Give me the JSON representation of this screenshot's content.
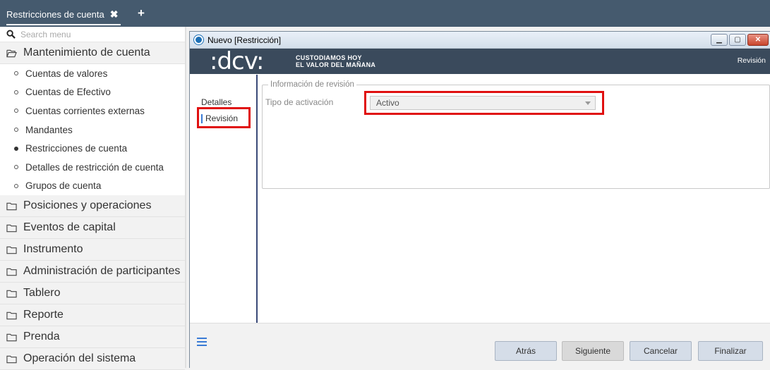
{
  "tabbar": {
    "tab_label": "Restricciones de cuenta",
    "close_glyph": "✖",
    "add_glyph": "+"
  },
  "sidebar": {
    "search_placeholder": "Search menu",
    "open_group": "Mantenimiento de cuenta",
    "subitems": [
      {
        "label": "Cuentas de valores",
        "active": false
      },
      {
        "label": "Cuentas de Efectivo",
        "active": false
      },
      {
        "label": "Cuentas corrientes externas",
        "active": false
      },
      {
        "label": "Mandantes",
        "active": false
      },
      {
        "label": "Restricciones de cuenta",
        "active": true
      },
      {
        "label": "Detalles de restricción de cuenta",
        "active": false
      },
      {
        "label": "Grupos de cuenta",
        "active": false
      }
    ],
    "groups": [
      "Posiciones y operaciones",
      "Eventos de capital",
      "Instrumento",
      "Administración de participantes",
      "Tablero",
      "Reporte",
      "Prenda",
      "Operación del sistema"
    ]
  },
  "window": {
    "title": "Nuevo [Restricción]",
    "brand_logo": ":dcv:",
    "tagline_line1": "CUSTODIAMOS HOY",
    "tagline_line2": "EL VALOR DEL MAÑANA",
    "brand_right": "Revisión",
    "steps": {
      "detalles": "Detalles",
      "revision": "Revisión"
    },
    "fieldset_legend": "Información de revisión",
    "field_label": "Tipo de activación",
    "field_value": "Activo",
    "buttons": {
      "back": "Atrás",
      "next": "Siguiente",
      "cancel": "Cancelar",
      "finish": "Finalizar"
    }
  },
  "colors": {
    "tabbar_bg": "#455a6e",
    "brandbar_bg": "#3a4a5c",
    "highlight_red": "#e01010",
    "accent_blue": "#3a7bd5"
  }
}
